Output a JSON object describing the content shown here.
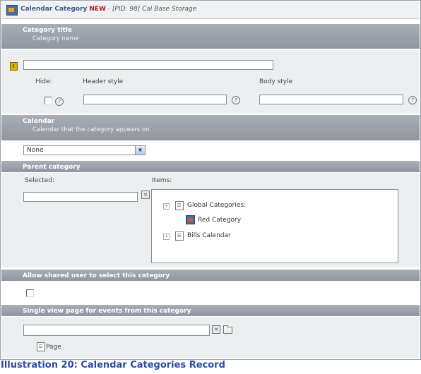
{
  "window": {
    "title": "Calendar Category",
    "new_badge": "NEW",
    "separator": "-",
    "pid_info": "[PID: 98] Cal Base Storage"
  },
  "sections": {
    "category_title": {
      "title": "Category title",
      "desc": "Category name",
      "value": ""
    },
    "styles": {
      "hide_label": "Hide:",
      "header_label": "Header style",
      "body_label": "Body style",
      "header_value": "",
      "body_value": ""
    },
    "calendar": {
      "title": "Calendar",
      "desc": "Calendar that the category appears on",
      "selected": "None"
    },
    "parent": {
      "title": "Parent category",
      "selected_label": "Selected:",
      "items_label": "Items:",
      "tree": [
        {
          "label": "Global Categories:",
          "level": 0
        },
        {
          "label": "Red Category",
          "level": 1
        },
        {
          "label": "Bills Calendar",
          "level": 0
        }
      ]
    },
    "allow_shared": {
      "title": "Allow shared user to select this category"
    },
    "single_view": {
      "title": "Single view page for events from this category",
      "page_label": "Page"
    }
  },
  "caption": "Illustration 20: Calendar Categories Record",
  "icons": {
    "help": "?",
    "required": "!"
  }
}
